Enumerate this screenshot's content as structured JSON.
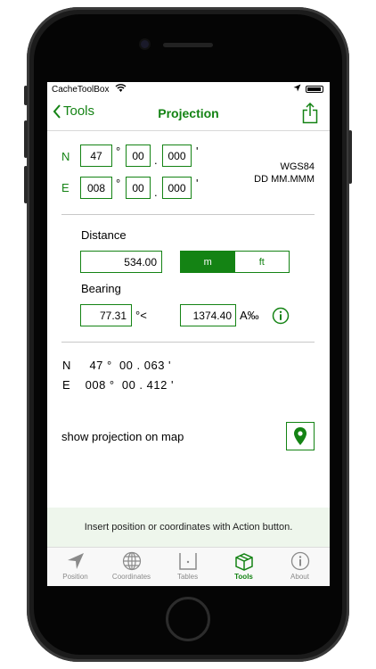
{
  "status_bar": {
    "carrier": "CacheToolBox"
  },
  "nav": {
    "back_label": "Tools",
    "title": "Projection"
  },
  "coords": {
    "n_label": "N",
    "e_label": "E",
    "n_deg": "47",
    "n_min": "00",
    "n_dec": "000",
    "e_deg": "008",
    "e_min": "00",
    "e_dec": "000",
    "deg_symbol": "°",
    "dot": ".",
    "min_symbol": "'",
    "datum": "WGS84",
    "format": "DD MM.MMM"
  },
  "distance": {
    "label": "Distance",
    "value": "534.00",
    "units": [
      {
        "label": "m",
        "selected": true
      },
      {
        "label": "ft",
        "selected": false
      }
    ]
  },
  "bearing": {
    "label": "Bearing",
    "degrees": "77.31",
    "degree_unit": "°<",
    "mils": "1374.40",
    "mils_unit": "A‰"
  },
  "result": {
    "n_line": "N     47 °  00 . 063 '",
    "e_line": "E    008 °  00 . 412 '"
  },
  "map_label": "show projection on map",
  "hint": "Insert position or coordinates with Action button.",
  "tabs": [
    {
      "label": "Position",
      "icon": "navigation-arrow-icon",
      "active": false
    },
    {
      "label": "Coordinates",
      "icon": "globe-icon",
      "active": false
    },
    {
      "label": "Tables",
      "icon": "table-icon",
      "active": false
    },
    {
      "label": "Tools",
      "icon": "toolbox-icon",
      "active": true
    },
    {
      "label": "About",
      "icon": "info-icon",
      "active": false
    }
  ],
  "colors": {
    "accent": "#148314",
    "hint_bg": "#eef6ec"
  }
}
